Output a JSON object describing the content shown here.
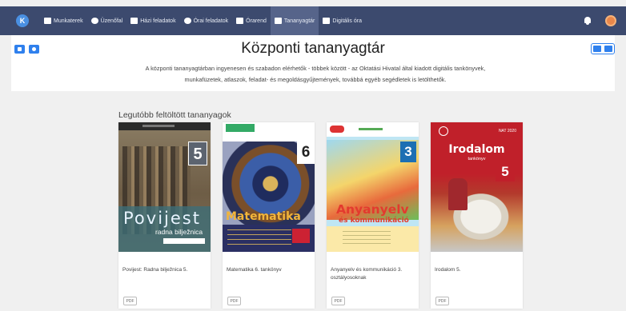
{
  "topbar": {
    "logo_text": "K",
    "nav": [
      {
        "label": "Munkaterek",
        "icon": "monitor-icon"
      },
      {
        "label": "Üzenőfal",
        "icon": "chat-bubble-icon"
      },
      {
        "label": "Házi feladatok",
        "icon": "document-icon"
      },
      {
        "label": "Órai feladatok",
        "icon": "chat-icon"
      },
      {
        "label": "Órarend",
        "icon": "calendar-icon"
      },
      {
        "label": "Tananyagtár",
        "icon": "book-icon",
        "active": true
      },
      {
        "label": "Digitális óra",
        "icon": "video-camera-icon"
      }
    ]
  },
  "header": {
    "title": "Központi tananyagtár",
    "description": "A központi tananyagtárban ingyenesen és szabadon elérhetők - többek között - az Oktatási Hivatal által kiadott digitális tankönyvek, munkafüzetek, atlaszok, feladat- és megoldásgyűjtemények, továbbá egyéb segédletek is letölthetők."
  },
  "section": {
    "title": "Legutóbb feltöltött tananyagok"
  },
  "books": [
    {
      "title": "Povijest: Radna bilježnica 5.",
      "cover_title": "Povijest",
      "cover_subtitle": "radna bilježnica",
      "grade": "5",
      "format": "PDF"
    },
    {
      "title": "Matematika 6. tankönyv",
      "cover_title": "Matematika",
      "grade": "6",
      "format": "PDF"
    },
    {
      "title": "Anyanyelv és kommunikáció 3. osztályosoknak",
      "cover_title": "Anyanyelv",
      "cover_subtitle": "és kommunikáció",
      "grade": "3",
      "format": "PDF"
    },
    {
      "title": "Irodalom 5.",
      "cover_title": "Irodalom",
      "cover_subtitle": "tankönyv",
      "cover_badge": "NAT 2020",
      "grade": "5",
      "format": "PDF"
    }
  ],
  "colors": {
    "topbar": "#3c4a6e",
    "accent": "#2f80ed",
    "page_bg": "#f0f0f0"
  }
}
